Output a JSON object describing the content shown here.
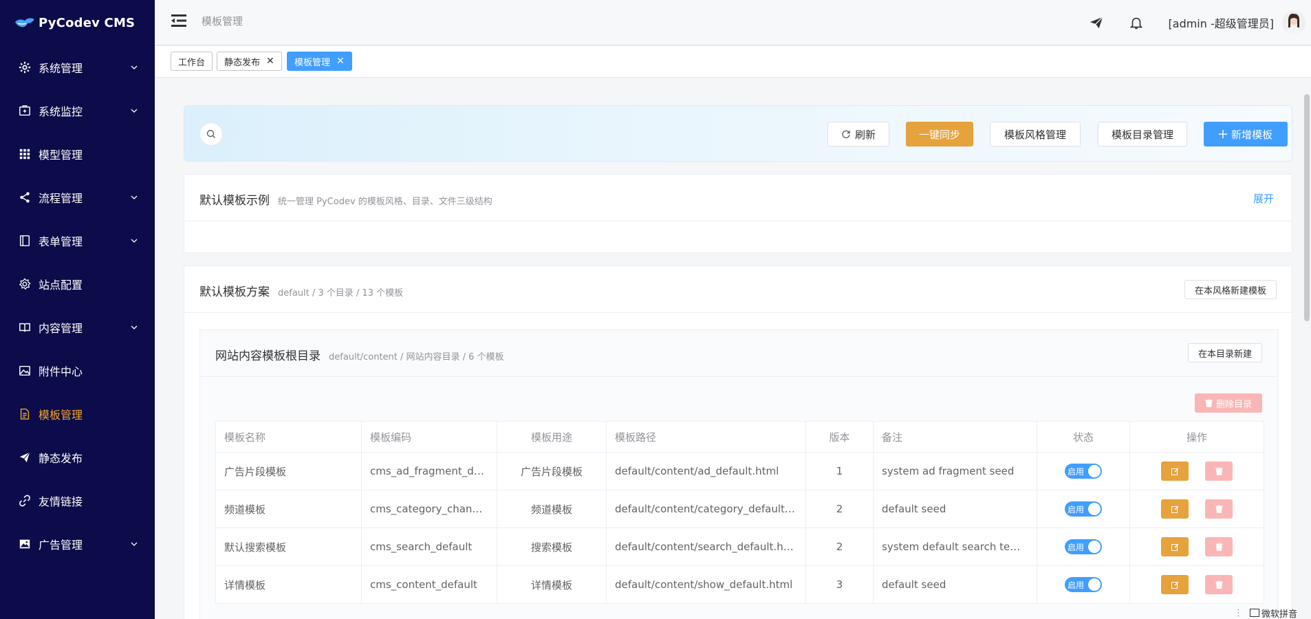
{
  "app": {
    "title": "PyCodev CMS"
  },
  "sidebar": {
    "items": [
      {
        "label": "系统管理",
        "icon": "gear-icon",
        "expandable": true
      },
      {
        "label": "系统监控",
        "icon": "monitor-icon",
        "expandable": true
      },
      {
        "label": "模型管理",
        "icon": "grid-icon",
        "expandable": false
      },
      {
        "label": "流程管理",
        "icon": "share-icon",
        "expandable": true
      },
      {
        "label": "表单管理",
        "icon": "form-icon",
        "expandable": true
      },
      {
        "label": "站点配置",
        "icon": "settings-icon",
        "expandable": false
      },
      {
        "label": "内容管理",
        "icon": "book-icon",
        "expandable": true
      },
      {
        "label": "附件中心",
        "icon": "picture-icon",
        "expandable": false
      },
      {
        "label": "模板管理",
        "icon": "document-icon",
        "expandable": false,
        "active": true
      },
      {
        "label": "静态发布",
        "icon": "send-icon",
        "expandable": false
      },
      {
        "label": "友情链接",
        "icon": "link-icon",
        "expandable": false
      },
      {
        "label": "广告管理",
        "icon": "image-icon",
        "expandable": true
      }
    ]
  },
  "header": {
    "breadcrumb": "模板管理",
    "user": "[admin -超级管理员]"
  },
  "tags": [
    {
      "label": "工作台",
      "closable": false,
      "active": false
    },
    {
      "label": "静态发布",
      "closable": true,
      "active": false
    },
    {
      "label": "模板管理",
      "closable": true,
      "active": true
    }
  ],
  "toolbar": {
    "refresh": "刷新",
    "sync": "一键同步",
    "style_manage": "模板风格管理",
    "dir_manage": "模板目录管理",
    "add": "新增模板"
  },
  "example_card": {
    "title": "默认模板示例",
    "subtitle": "统一管理 PyCodev 的模板风格、目录、文件三级结构",
    "expand": "展开"
  },
  "scheme_card": {
    "title": "默认模板方案",
    "subtitle": "default / 3 个目录 / 13 个模板",
    "new_in_style": "在本风格新建模板",
    "directory": {
      "title": "网站内容模板根目录",
      "subtitle": "default/content / 网站内容目录 / 6 个模板",
      "new_in_dir": "在本目录新建",
      "delete_dir": "删除目录",
      "columns": [
        "模板名称",
        "模板编码",
        "模板用途",
        "模板路径",
        "版本",
        "备注",
        "状态",
        "操作"
      ],
      "rows": [
        {
          "name": "广告片段模板",
          "code": "cms_ad_fragment_def...",
          "usage": "广告片段模板",
          "path": "default/content/ad_default.html",
          "version": "1",
          "remark": "system ad fragment seed",
          "status": "启用"
        },
        {
          "name": "频道模板",
          "code": "cms_category_channel...",
          "usage": "频道模板",
          "path": "default/content/category_default.ht...",
          "version": "2",
          "remark": "default seed",
          "status": "启用"
        },
        {
          "name": "默认搜索模板",
          "code": "cms_search_default",
          "usage": "搜索模板",
          "path": "default/content/search_default.html",
          "version": "2",
          "remark": "system default search templ...",
          "status": "启用"
        },
        {
          "name": "详情模板",
          "code": "cms_content_default",
          "usage": "详情模板",
          "path": "default/content/show_default.html",
          "version": "3",
          "remark": "default seed",
          "status": "启用"
        }
      ]
    }
  },
  "ime": {
    "label": "微软拼音"
  },
  "colors": {
    "sidebar_bg": "#0c0c4a",
    "accent": "#409eff",
    "warning": "#e6a23c",
    "active_menu": "#f5a623",
    "danger_light": "#fab6b6"
  }
}
